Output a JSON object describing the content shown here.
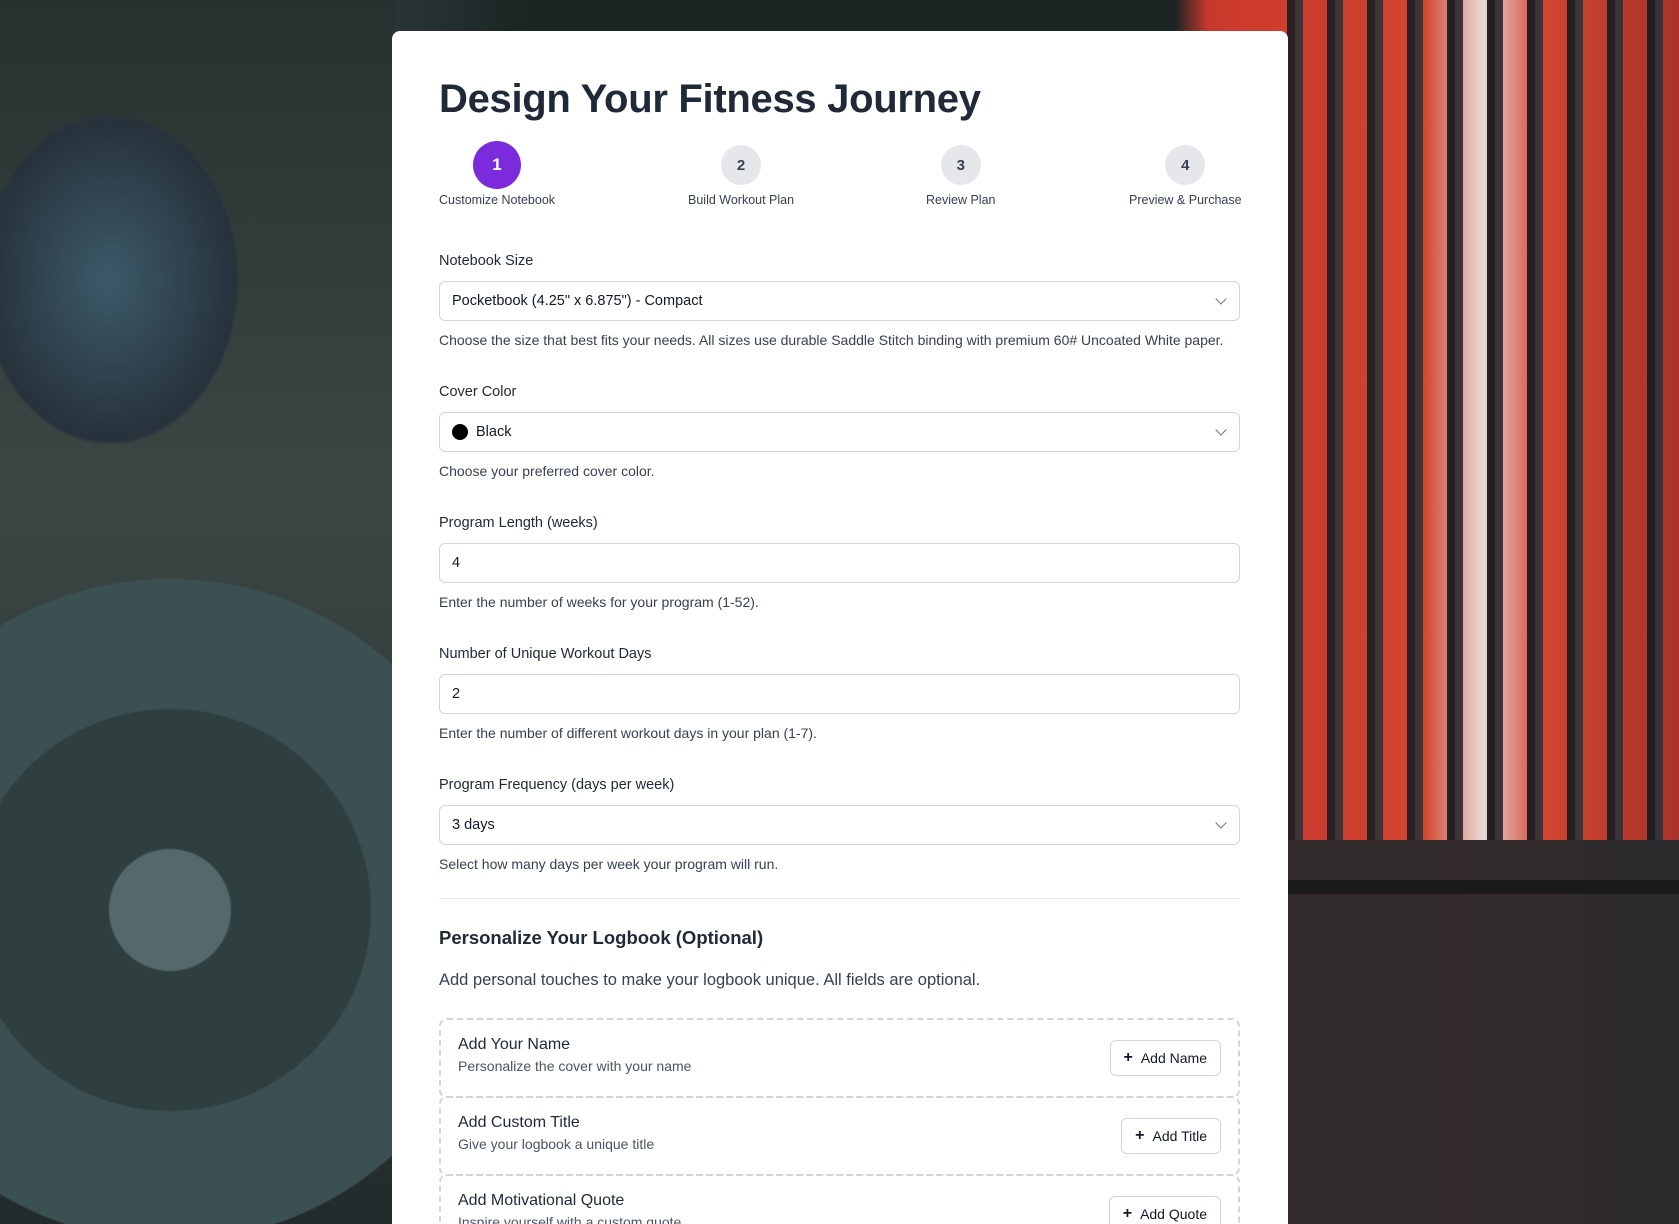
{
  "page": {
    "title": "Design Your Fitness Journey"
  },
  "stepper": {
    "steps": [
      {
        "number": "1",
        "label": "Customize Notebook",
        "active": true
      },
      {
        "number": "2",
        "label": "Build Workout Plan",
        "active": false
      },
      {
        "number": "3",
        "label": "Review Plan",
        "active": false
      },
      {
        "number": "4",
        "label": "Preview & Purchase",
        "active": false
      }
    ],
    "accent_color": "#7c2bdc"
  },
  "form": {
    "notebook_size": {
      "label": "Notebook Size",
      "value": "Pocketbook (4.25\" x 6.875\") - Compact",
      "hint": "Choose the size that best fits your needs. All sizes use durable Saddle Stitch binding with premium 60# Uncoated White paper."
    },
    "cover_color": {
      "label": "Cover Color",
      "value": "Black",
      "swatch": "#000000",
      "hint": "Choose your preferred cover color."
    },
    "program_length": {
      "label": "Program Length (weeks)",
      "value": "4",
      "hint": "Enter the number of weeks for your program (1-52)."
    },
    "unique_days": {
      "label": "Number of Unique Workout Days",
      "value": "2",
      "hint": "Enter the number of different workout days in your plan (1-7)."
    },
    "frequency": {
      "label": "Program Frequency (days per week)",
      "value": "3 days",
      "hint": "Select how many days per week your program will run."
    }
  },
  "personalize": {
    "title": "Personalize Your Logbook (Optional)",
    "description": "Add personal touches to make your logbook unique. All fields are optional.",
    "options": [
      {
        "title": "Add Your Name",
        "subtitle": "Personalize the cover with your name",
        "button": "Add Name"
      },
      {
        "title": "Add Custom Title",
        "subtitle": "Give your logbook a unique title",
        "button": "Add Title"
      },
      {
        "title": "Add Motivational Quote",
        "subtitle": "Inspire yourself with a custom quote",
        "button": "Add Quote"
      }
    ]
  }
}
